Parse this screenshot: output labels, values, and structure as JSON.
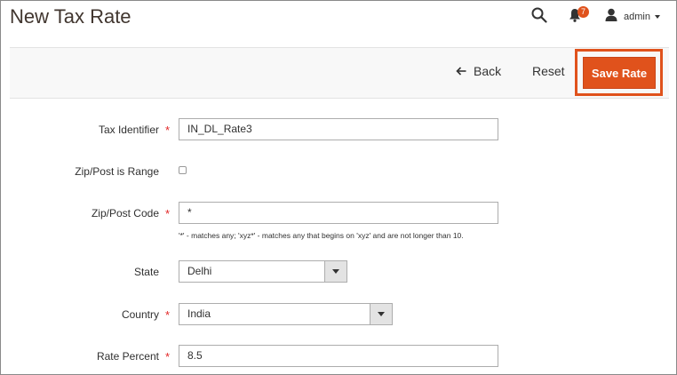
{
  "header": {
    "title": "New Tax Rate",
    "notifications_count": "7",
    "user_name": "admin"
  },
  "actions": {
    "back_label": "Back",
    "reset_label": "Reset",
    "save_label": "Save Rate"
  },
  "form": {
    "tax_identifier": {
      "label": "Tax Identifier",
      "value": "IN_DL_Rate3",
      "required": true
    },
    "zip_is_range": {
      "label": "Zip/Post is Range",
      "checked": false
    },
    "zip_code": {
      "label": "Zip/Post Code",
      "value": "*",
      "required": true,
      "note": "'*' - matches any; 'xyz*' - matches any that begins on 'xyz' and are not longer than 10."
    },
    "state": {
      "label": "State",
      "value": "Delhi"
    },
    "country": {
      "label": "Country",
      "value": "India",
      "required": true
    },
    "rate_percent": {
      "label": "Rate Percent",
      "value": "8.5",
      "required": true
    }
  },
  "required_marker": "*",
  "colors": {
    "accent": "#e0521c",
    "required": "#e22626"
  }
}
